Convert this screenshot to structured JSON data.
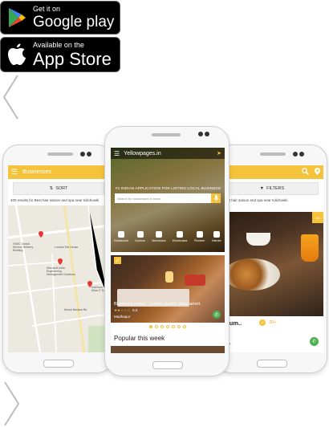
{
  "badges": {
    "google_play": {
      "small": "Get it on",
      "big": "Google play"
    },
    "app_store": {
      "small": "Available on the",
      "big": "App Store"
    }
  },
  "left_phone": {
    "appbar_title": "Businesses",
    "sort_label": "SORT",
    "results_text": "400 results for Best hair saloon and spa near tolichowki",
    "map_labels": [
      "HSBC Global Service Delivery Building",
      "Lonnan Tea House",
      "Microsoft India Engineering Management Solutions",
      "Kohinoor Mina IT Park",
      "Mount Banjara Rd"
    ]
  },
  "center_phone": {
    "app_title": "Yellowpages.in",
    "tagline": "#1 INDIAN APPLICATION FOR LISTING LOCAL BUSINESS",
    "search_placeholder": "Search for businesses in India",
    "categories": [
      "Restaurant",
      "Doctors",
      "Mechanics",
      "Electricians",
      "Plumber",
      "Hairdre"
    ],
    "listing": {
      "name": "Business name . Lorem ipsum dolor amet.",
      "stars": "★★☆☆☆",
      "rating_count": "5.0",
      "city": "Madhapur"
    },
    "section_title": "Popular this week"
  },
  "right_phone": {
    "filters_label": "FILTERS",
    "results_text": "Best hair saloon and spa near tolichowki",
    "ribbon": "Ad",
    "listing_name": "psum..",
    "badge_text": "JD+",
    "category": "style"
  },
  "colors": {
    "accent": "#f5c33b",
    "call_green": "#4caf50"
  }
}
